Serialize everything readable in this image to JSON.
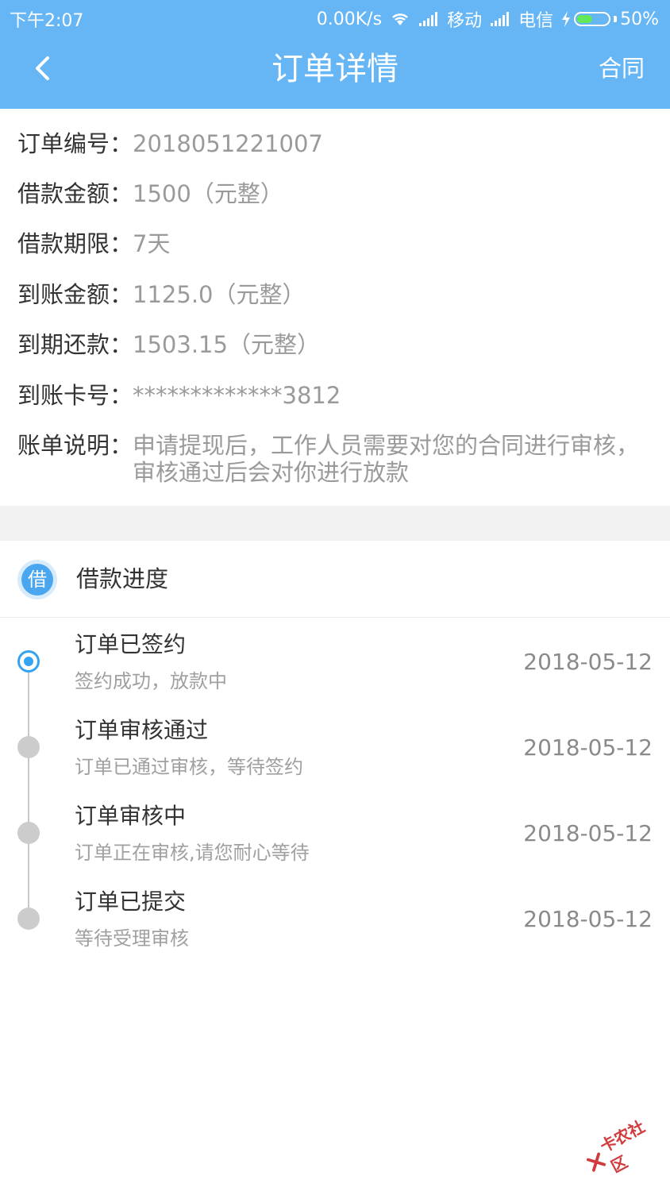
{
  "status_bar": {
    "time": "下午2:07",
    "speed": "0.00K/s",
    "carrier1": "移动",
    "carrier2": "电信",
    "battery": "50%",
    "battery_level": 0.5
  },
  "nav": {
    "back_icon": "chevron-left-icon",
    "title": "订单详情",
    "contract": "合同"
  },
  "order": [
    {
      "label": "订单编号：",
      "value": "2018051221007"
    },
    {
      "label": "借款金额：",
      "value": "1500（元整）"
    },
    {
      "label": "借款期限：",
      "value": "7天"
    },
    {
      "label": "到账金额：",
      "value": "1125.0（元整）"
    },
    {
      "label": "到期还款：",
      "value": "1503.15（元整）"
    },
    {
      "label": "到账卡号：",
      "value": "*************3812"
    },
    {
      "label": "账单说明：",
      "value": "申请提现后，工作人员需要对您的合同进行审核，审核通过后会对你进行放款"
    }
  ],
  "progress": {
    "badge": "借",
    "title": "借款进度",
    "steps": [
      {
        "title": "订单已签约",
        "desc": "签约成功，放款中",
        "date": "2018-05-12",
        "active": true
      },
      {
        "title": "订单审核通过",
        "desc": "订单已通过审核，等待签约",
        "date": "2018-05-12",
        "active": false
      },
      {
        "title": "订单审核中",
        "desc": "订单正在审核,请您耐心等待",
        "date": "2018-05-12",
        "active": false
      },
      {
        "title": "订单已提交",
        "desc": "等待受理审核",
        "date": "2018-05-12",
        "active": false
      }
    ]
  },
  "watermark": "卡农社区",
  "colors": {
    "header": "#66b6f5",
    "accent": "#36a3f2"
  }
}
